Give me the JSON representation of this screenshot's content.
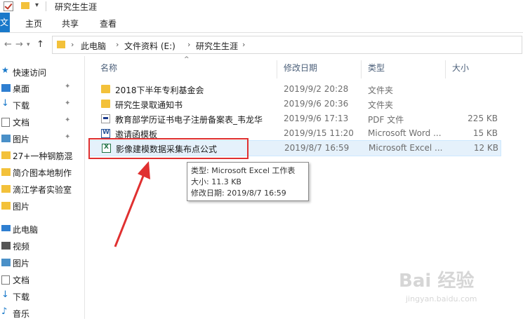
{
  "window": {
    "title": "研究生生涯"
  },
  "ribbon": {
    "file_tab": "文件",
    "tabs": [
      "主页",
      "共享",
      "查看"
    ]
  },
  "address": {
    "crumbs": [
      "此电脑",
      "文件资料 (E:)",
      "研究生生涯"
    ]
  },
  "sidebar": {
    "items": [
      {
        "label": "快速访问",
        "icon": "star-icon",
        "pinned": false
      },
      {
        "label": "桌面",
        "icon": "desktop-icon",
        "pinned": true
      },
      {
        "label": "下载",
        "icon": "download-icon",
        "pinned": true
      },
      {
        "label": "文档",
        "icon": "document-icon",
        "pinned": true
      },
      {
        "label": "图片",
        "icon": "picture-icon",
        "pinned": true
      },
      {
        "label": "27+一种钢筋混",
        "icon": "folder-icon",
        "pinned": false
      },
      {
        "label": "简介图本地制作",
        "icon": "folder-icon",
        "pinned": false
      },
      {
        "label": "滴江学者实验室",
        "icon": "folder-icon",
        "pinned": false
      },
      {
        "label": "图片",
        "icon": "folder-icon",
        "pinned": false
      },
      {
        "label": "此电脑",
        "icon": "computer-icon",
        "pinned": false
      },
      {
        "label": "视频",
        "icon": "video-icon",
        "pinned": false
      },
      {
        "label": "图片",
        "icon": "picture-icon",
        "pinned": false
      },
      {
        "label": "文档",
        "icon": "document-icon",
        "pinned": false
      },
      {
        "label": "下载",
        "icon": "download-icon",
        "pinned": false
      },
      {
        "label": "音乐",
        "icon": "music-icon",
        "pinned": false
      }
    ]
  },
  "columns": {
    "name": "名称",
    "date": "修改日期",
    "type": "类型",
    "size": "大小"
  },
  "files": [
    {
      "name": "2018下半年专利基金会",
      "date": "2019/9/2 20:28",
      "type": "文件夹",
      "size": "",
      "icon": "folder-icon"
    },
    {
      "name": "研究生录取通知书",
      "date": "2019/9/6 20:36",
      "type": "文件夹",
      "size": "",
      "icon": "folder-icon"
    },
    {
      "name": "教育部学历证书电子注册备案表_韦龙华",
      "date": "2019/9/6 17:13",
      "type": "PDF 文件",
      "size": "225 KB",
      "icon": "pdf-icon"
    },
    {
      "name": "邀请函模板",
      "date": "2019/9/15 11:20",
      "type": "Microsoft Word ...",
      "size": "15 KB",
      "icon": "word-icon"
    },
    {
      "name": "影像建模数据采集布点公式",
      "date": "2019/8/7 16:59",
      "type": "Microsoft Excel ...",
      "size": "12 KB",
      "icon": "excel-icon",
      "selected": true
    }
  ],
  "tooltip": {
    "type_line": "类型: Microsoft Excel 工作表",
    "size_line": "大小: 11.3 KB",
    "date_line": "修改日期: 2019/8/7 16:59"
  },
  "watermark": {
    "text": "Bai 经验",
    "sub": "jingyan.baidu.com"
  },
  "colors": {
    "accent": "#1979ca",
    "highlight": "#e03030",
    "selection": "#e5f1fb",
    "folder": "#f3c13a"
  }
}
